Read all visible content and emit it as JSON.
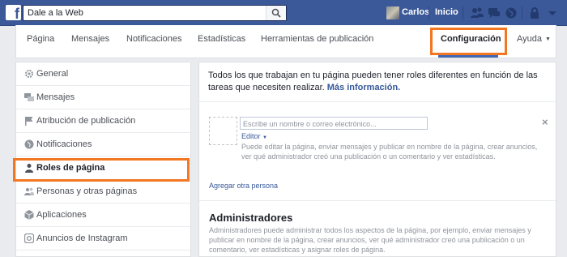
{
  "topbar": {
    "search_value": "Dale a la Web",
    "user_name": "Carlos",
    "home_label": "Inicio",
    "colors": {
      "bar": "#3b5998"
    }
  },
  "page_tabs": [
    {
      "label": "Página"
    },
    {
      "label": "Mensajes"
    },
    {
      "label": "Notificaciones"
    },
    {
      "label": "Estadísticas"
    },
    {
      "label": "Herramientas de publicación"
    },
    {
      "label": "Configuración",
      "active": true
    },
    {
      "label": "Ayuda",
      "dropdown": true
    }
  ],
  "sidebar": {
    "items": [
      {
        "label": "General",
        "icon": "gear-icon"
      },
      {
        "label": "Mensajes",
        "icon": "messages-icon"
      },
      {
        "label": "Atribución de publicación",
        "icon": "flag-icon"
      },
      {
        "label": "Notificaciones",
        "icon": "globe-icon"
      },
      {
        "label": "Roles de página",
        "icon": "person-icon",
        "active": true
      },
      {
        "label": "Personas y otras páginas",
        "icon": "people-icon"
      },
      {
        "label": "Aplicaciones",
        "icon": "cube-icon"
      },
      {
        "label": "Anuncios de Instagram",
        "icon": "instagram-icon"
      }
    ]
  },
  "main": {
    "intro_text": "Todos los que trabajan en tu página pueden tener roles diferentes en función de las tareas que necesiten realizar.",
    "intro_link": "Más información.",
    "name_placeholder": "Escribe un nombre o correo electrónico...",
    "role_label": "Editor",
    "role_description": "Puede editar la página, enviar mensajes y publicar en nombre de la página, crear anuncios, ver qué administrador creó una publicación o un comentario y ver estadísticas.",
    "add_person": "Agregar otra persona",
    "admins_title": "Administradores",
    "admins_description": "Administradores puede administrar todos los aspectos de la página, por ejemplo, enviar mensajes y publicar en nombre de la página, crear anuncios, ver qué administrador creó una publicación o un comentario, ver estadísticas y asignar roles de página."
  },
  "highlight_color": "#f37722"
}
